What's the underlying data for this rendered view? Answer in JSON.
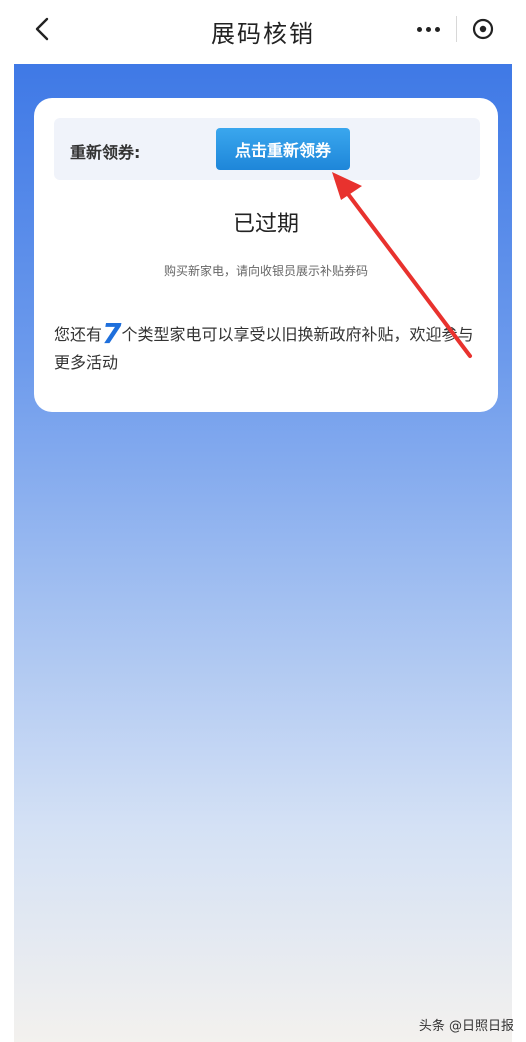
{
  "navbar": {
    "title": "展码核销",
    "back_icon": "chevron-left-icon",
    "more_icon": "more-dots-icon",
    "close_icon": "close-circle-icon"
  },
  "card": {
    "relabel_label": "重新领券:",
    "relabel_button": "点击重新领券",
    "status": "已过期",
    "hint": "购买新家电，请向收银员展示补贴券码",
    "notice_prefix": "您还有",
    "notice_count": "7",
    "notice_suffix": "个类型家电可以享受以旧换新政府补贴，欢迎参与更多活动"
  },
  "watermark": "头条 @日照日报",
  "colors": {
    "accent_blue": "#1e86d9",
    "annotation_arrow": "#e8322e",
    "background_top": "#3f79e6"
  }
}
